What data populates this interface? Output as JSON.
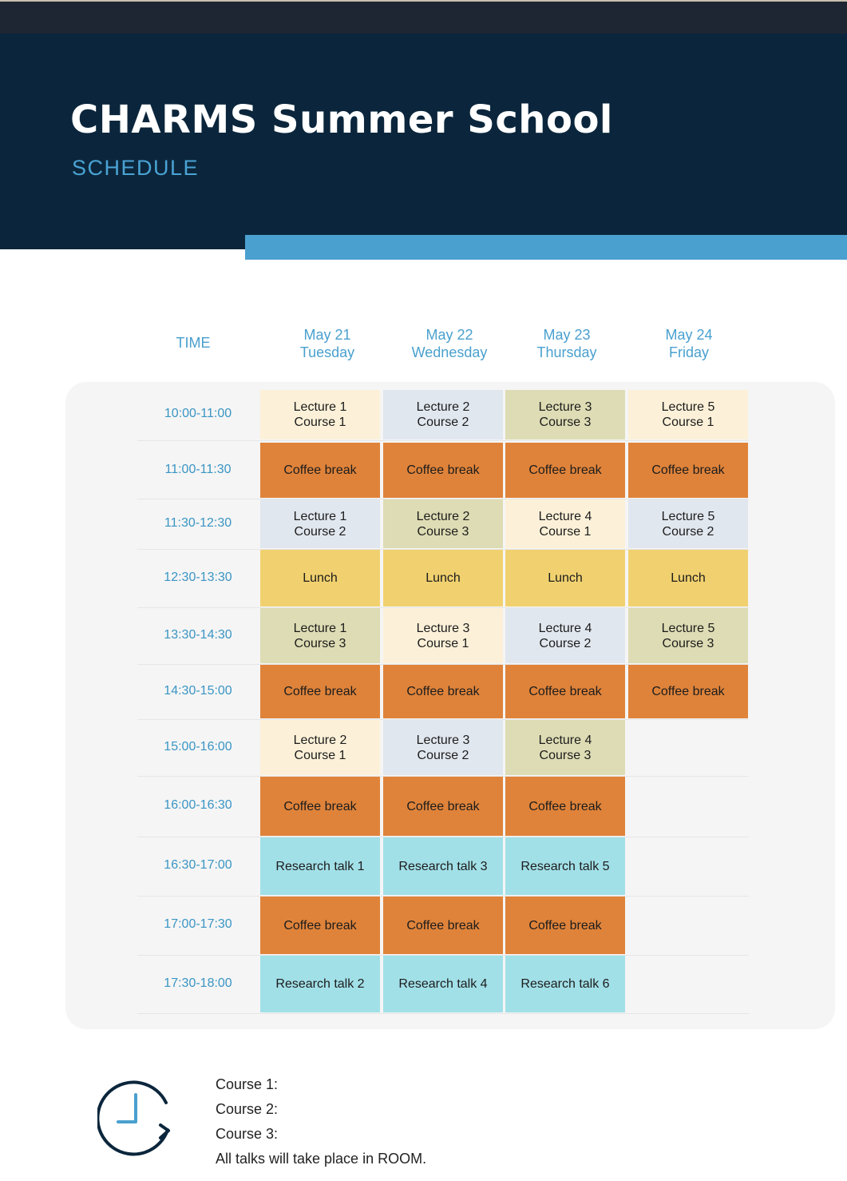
{
  "header": {
    "title": "CHARMS Summer School",
    "subtitle": "SCHEDULE"
  },
  "columns": {
    "time_label": "TIME",
    "days": [
      {
        "date": "May 21",
        "weekday": "Tuesday"
      },
      {
        "date": "May 22",
        "weekday": "Wednesday"
      },
      {
        "date": "May 23",
        "weekday": "Thursday"
      },
      {
        "date": "May 24",
        "weekday": "Friday"
      }
    ]
  },
  "colors": {
    "header_bg": "#0b263c",
    "accent_blue": "#4aa0cf",
    "course1": "#fcf1d8",
    "course2": "#e1e7ef",
    "course3": "#dedcb4",
    "coffee_break": "#df833a",
    "lunch": "#f1d16f",
    "research_talk": "#a2e0e8"
  },
  "schedule": [
    {
      "time": "10:00-11:00",
      "cells": [
        {
          "lines": [
            "Lecture 1",
            "Course 1"
          ],
          "kind": "course1"
        },
        {
          "lines": [
            "Lecture 2",
            "Course 2"
          ],
          "kind": "course2"
        },
        {
          "lines": [
            "Lecture 3",
            "Course 3"
          ],
          "kind": "course3"
        },
        {
          "lines": [
            "Lecture 5",
            "Course 1"
          ],
          "kind": "course1"
        }
      ]
    },
    {
      "time": "11:00-11:30",
      "cells": [
        {
          "lines": [
            "Coffee break"
          ],
          "kind": "coffee_break"
        },
        {
          "lines": [
            "Coffee break"
          ],
          "kind": "coffee_break"
        },
        {
          "lines": [
            "Coffee break"
          ],
          "kind": "coffee_break"
        },
        {
          "lines": [
            "Coffee break"
          ],
          "kind": "coffee_break"
        }
      ]
    },
    {
      "time": "11:30-12:30",
      "cells": [
        {
          "lines": [
            "Lecture 1",
            "Course 2"
          ],
          "kind": "course2"
        },
        {
          "lines": [
            "Lecture 2",
            "Course 3"
          ],
          "kind": "course3"
        },
        {
          "lines": [
            "Lecture 4",
            "Course 1"
          ],
          "kind": "course1"
        },
        {
          "lines": [
            "Lecture 5",
            "Course 2"
          ],
          "kind": "course2"
        }
      ]
    },
    {
      "time": "12:30-13:30",
      "cells": [
        {
          "lines": [
            "Lunch"
          ],
          "kind": "lunch"
        },
        {
          "lines": [
            "Lunch"
          ],
          "kind": "lunch"
        },
        {
          "lines": [
            "Lunch"
          ],
          "kind": "lunch"
        },
        {
          "lines": [
            "Lunch"
          ],
          "kind": "lunch"
        }
      ]
    },
    {
      "time": "13:30-14:30",
      "cells": [
        {
          "lines": [
            "Lecture 1",
            "Course 3"
          ],
          "kind": "course3"
        },
        {
          "lines": [
            "Lecture 3",
            "Course 1"
          ],
          "kind": "course1"
        },
        {
          "lines": [
            "Lecture 4",
            "Course 2"
          ],
          "kind": "course2"
        },
        {
          "lines": [
            "Lecture 5",
            "Course 3"
          ],
          "kind": "course3"
        }
      ]
    },
    {
      "time": "14:30-15:00",
      "cells": [
        {
          "lines": [
            "Coffee break"
          ],
          "kind": "coffee_break"
        },
        {
          "lines": [
            "Coffee break"
          ],
          "kind": "coffee_break"
        },
        {
          "lines": [
            "Coffee break"
          ],
          "kind": "coffee_break"
        },
        {
          "lines": [
            "Coffee break"
          ],
          "kind": "coffee_break"
        }
      ]
    },
    {
      "time": "15:00-16:00",
      "cells": [
        {
          "lines": [
            "Lecture 2",
            "Course 1"
          ],
          "kind": "course1"
        },
        {
          "lines": [
            "Lecture 3",
            "Course 2"
          ],
          "kind": "course2"
        },
        {
          "lines": [
            "Lecture 4",
            "Course 3"
          ],
          "kind": "course3"
        },
        null
      ]
    },
    {
      "time": "16:00-16:30",
      "cells": [
        {
          "lines": [
            "Coffee break"
          ],
          "kind": "coffee_break"
        },
        {
          "lines": [
            "Coffee break"
          ],
          "kind": "coffee_break"
        },
        {
          "lines": [
            "Coffee break"
          ],
          "kind": "coffee_break"
        },
        null
      ]
    },
    {
      "time": "16:30-17:00",
      "cells": [
        {
          "lines": [
            "Research talk 1"
          ],
          "kind": "research_talk"
        },
        {
          "lines": [
            "Research talk 3"
          ],
          "kind": "research_talk"
        },
        {
          "lines": [
            "Research talk 5"
          ],
          "kind": "research_talk"
        },
        null
      ]
    },
    {
      "time": "17:00-17:30",
      "cells": [
        {
          "lines": [
            "Coffee break"
          ],
          "kind": "coffee_break"
        },
        {
          "lines": [
            "Coffee break"
          ],
          "kind": "coffee_break"
        },
        {
          "lines": [
            "Coffee break"
          ],
          "kind": "coffee_break"
        },
        null
      ]
    },
    {
      "time": "17:30-18:00",
      "cells": [
        {
          "lines": [
            "Research talk 2"
          ],
          "kind": "research_talk"
        },
        {
          "lines": [
            "Research talk 4"
          ],
          "kind": "research_talk"
        },
        {
          "lines": [
            "Research talk 6"
          ],
          "kind": "research_talk"
        },
        null
      ]
    }
  ],
  "legend": {
    "icon": "clock-refresh-icon",
    "lines": [
      "Course 1:",
      "Course 2:",
      "Course 3:",
      "All talks will take place in ROOM."
    ]
  }
}
